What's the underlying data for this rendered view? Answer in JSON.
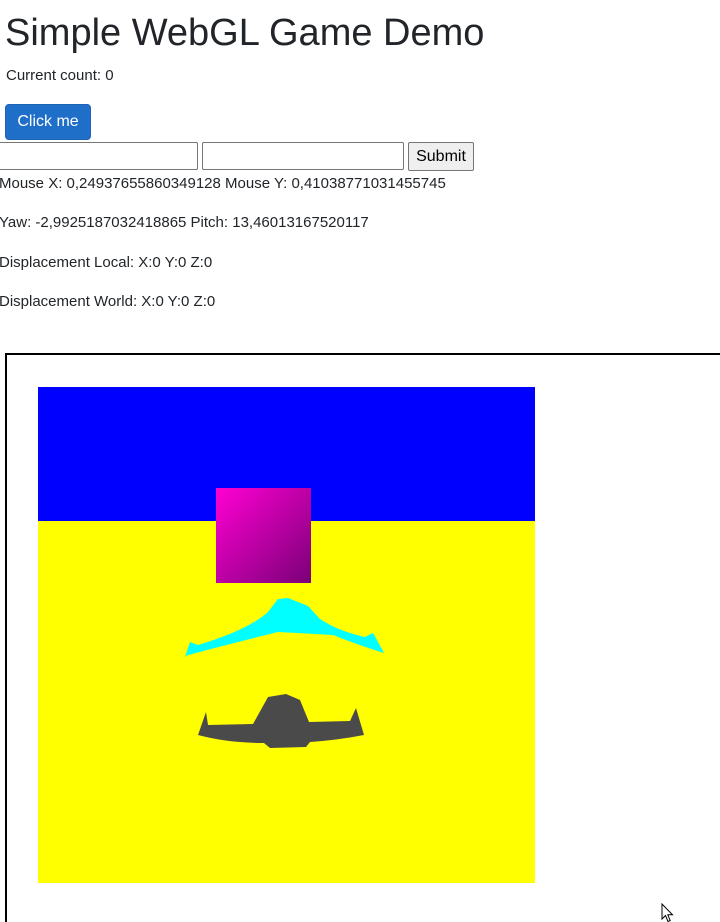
{
  "page": {
    "title": "Simple WebGL Game Demo",
    "count_text": "Current count: 0"
  },
  "controls": {
    "click_label": "Click me",
    "input_a_value": "",
    "input_b_value": "",
    "submit_label": "Submit"
  },
  "info": {
    "mouse": "Mouse X: 0,24937655860349128 Mouse Y: 0,41038771031455745",
    "yaw_pitch": "Yaw: -2,9925187032418865 Pitch: 13,46013167520117",
    "displacement_local": "Displacement Local: X:0 Y:0 Z:0",
    "displacement_world": "Displacement World: X:0 Y:0 Z:0"
  },
  "scene": {
    "sky_color": "#0000ff",
    "ground_color": "#ffff00",
    "cube_gradient": [
      "#ff00d2",
      "#7a0078"
    ],
    "enemy_ship_color": "#00ffff",
    "player_ship_color": "#4a4a4a"
  },
  "icons": {
    "cursor": "mouse-pointer-icon"
  }
}
